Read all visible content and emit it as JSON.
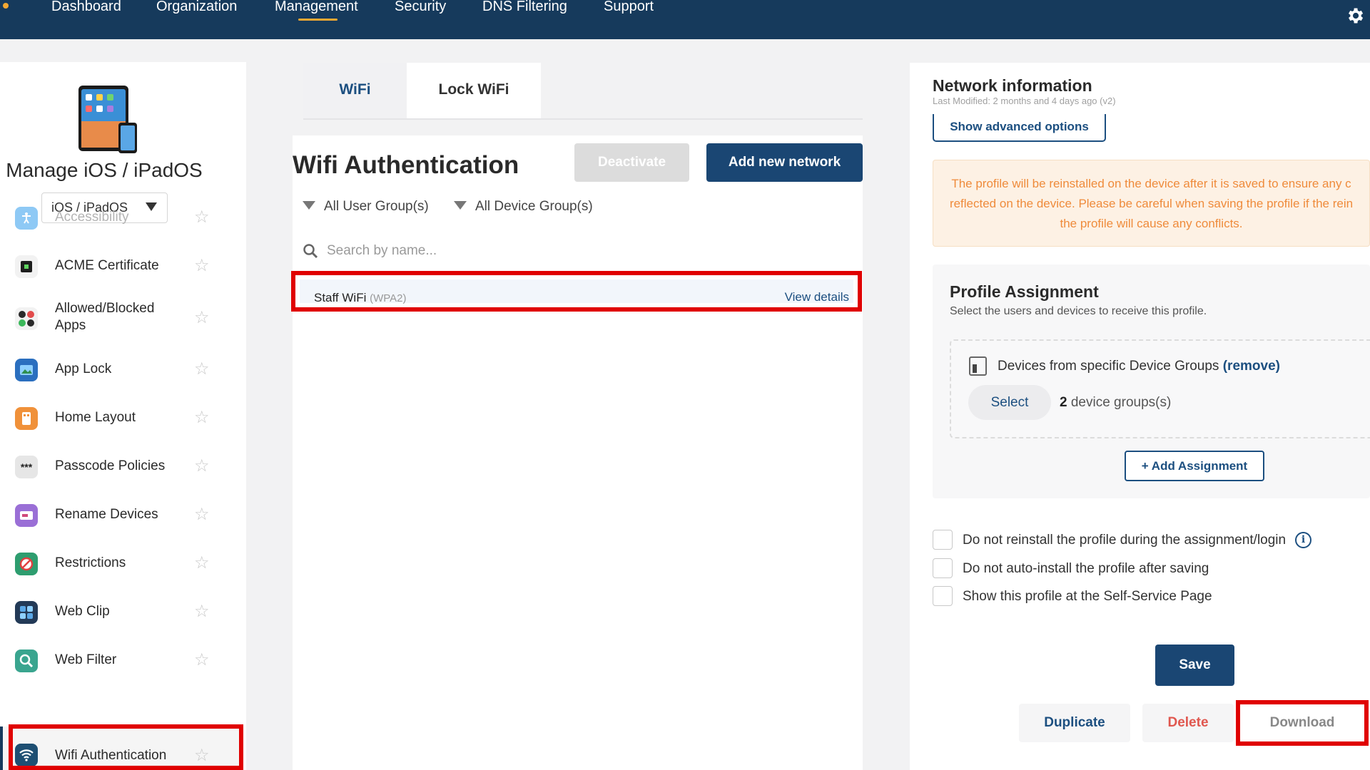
{
  "nav": {
    "items": [
      "Dashboard",
      "Organization",
      "Management",
      "Security",
      "DNS Filtering",
      "Support"
    ],
    "active": "Management"
  },
  "sidebar": {
    "title": "Manage iOS / iPadOS",
    "os_select": "iOS / iPadOS",
    "items": [
      {
        "label": "Accessibility",
        "icon": "accessibility-icon",
        "color": "#8ec9f5",
        "disabled": true
      },
      {
        "label": "ACME Certificate",
        "icon": "certificate-icon",
        "color": "#1d1d1d"
      },
      {
        "label": "Allowed/Blocked Apps",
        "icon": "apps-icon",
        "color": "#2a2a2a"
      },
      {
        "label": "App Lock",
        "icon": "app-lock-icon",
        "color": "#2b6fbf"
      },
      {
        "label": "Home Layout",
        "icon": "home-layout-icon",
        "color": "#f0913a"
      },
      {
        "label": "Passcode Policies",
        "icon": "passcode-icon",
        "color": "#e6e6e6",
        "glyph": "***"
      },
      {
        "label": "Rename Devices",
        "icon": "rename-icon",
        "color": "#9a6fd6"
      },
      {
        "label": "Restrictions",
        "icon": "restrictions-icon",
        "color": "#2e9d6f"
      },
      {
        "label": "Web Clip",
        "icon": "web-clip-icon",
        "color": "#233a57"
      },
      {
        "label": "Web Filter",
        "icon": "web-filter-icon",
        "color": "#3aa58f"
      },
      {
        "label": "Wifi Authentication",
        "icon": "wifi-icon",
        "color": "#1e4f73",
        "active": true
      }
    ]
  },
  "main": {
    "tabs": [
      {
        "label": "WiFi",
        "active": true
      },
      {
        "label": "Lock WiFi"
      }
    ],
    "title": "Wifi Authentication",
    "deactivate_label": "Deactivate",
    "add_network_label": "Add new network",
    "filters": {
      "user_groups": "All User Group(s)",
      "device_groups": "All Device Group(s)"
    },
    "search_placeholder": "Search by name...",
    "networks": [
      {
        "name": "Staff WiFi",
        "security": "(WPA2)",
        "action": "View details"
      }
    ]
  },
  "right": {
    "title": "Network information",
    "last_modified": "Last Modified: 2 months and 4 days ago (v2)",
    "advanced_label": "Show advanced options",
    "warning_lines": [
      "The profile will be reinstalled on the device after it is saved to ensure any c",
      "reflected on the device. Please be careful when saving the profile if the rein",
      "the profile will cause any conflicts."
    ],
    "assignment": {
      "title": "Profile Assignment",
      "subtitle": "Select the users and devices to receive this profile.",
      "device_groups_text": "Devices from specific Device Groups",
      "remove_label": "(remove)",
      "select_label": "Select",
      "count": "2",
      "count_suffix": " device groups(s)",
      "add_label": "+ Add Assignment"
    },
    "options": [
      "Do not reinstall the profile during the assignment/login",
      "Do not auto-install the profile after saving",
      "Show this profile at the Self-Service Page"
    ],
    "save_label": "Save",
    "duplicate_label": "Duplicate",
    "delete_label": "Delete",
    "download_label": "Download"
  },
  "colors": {
    "nav_bg": "#163a5c",
    "primary": "#1a4673",
    "accent": "#f2a833",
    "highlight": "#e00000",
    "warning_text": "#ef8b3b"
  }
}
